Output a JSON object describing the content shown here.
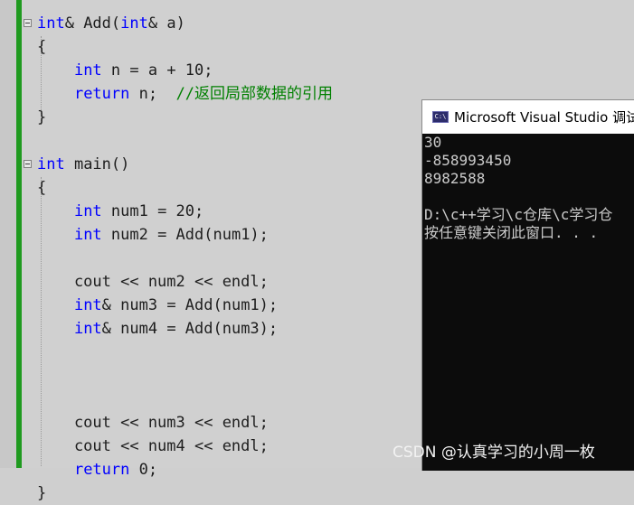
{
  "editor": {
    "lines": [
      {
        "parts": [
          {
            "t": "int",
            "c": "kw"
          },
          {
            "t": "& Add("
          },
          {
            "t": "int",
            "c": "kw"
          },
          {
            "t": "& a)"
          }
        ]
      },
      {
        "parts": [
          {
            "t": "{"
          }
        ]
      },
      {
        "parts": [
          {
            "t": "    "
          },
          {
            "t": "int",
            "c": "kw"
          },
          {
            "t": " n = a + 10;"
          }
        ]
      },
      {
        "parts": [
          {
            "t": "    "
          },
          {
            "t": "return",
            "c": "kw"
          },
          {
            "t": " n;  "
          },
          {
            "t": "//返回局部数据的引用",
            "c": "cm"
          }
        ]
      },
      {
        "parts": [
          {
            "t": "}"
          }
        ]
      },
      {
        "parts": [
          {
            "t": ""
          }
        ]
      },
      {
        "parts": [
          {
            "t": "int",
            "c": "kw"
          },
          {
            "t": " main()"
          }
        ]
      },
      {
        "parts": [
          {
            "t": "{"
          }
        ]
      },
      {
        "parts": [
          {
            "t": "    "
          },
          {
            "t": "int",
            "c": "kw"
          },
          {
            "t": " num1 = 20;"
          }
        ]
      },
      {
        "parts": [
          {
            "t": "    "
          },
          {
            "t": "int",
            "c": "kw"
          },
          {
            "t": " num2 = Add(num1);"
          }
        ]
      },
      {
        "parts": [
          {
            "t": ""
          }
        ]
      },
      {
        "parts": [
          {
            "t": "    cout << num2 << endl;"
          }
        ]
      },
      {
        "parts": [
          {
            "t": "    "
          },
          {
            "t": "int",
            "c": "kw"
          },
          {
            "t": "& num3 = Add(num1);"
          }
        ]
      },
      {
        "parts": [
          {
            "t": "    "
          },
          {
            "t": "int",
            "c": "kw"
          },
          {
            "t": "& num4 = Add(num3);"
          }
        ]
      },
      {
        "parts": [
          {
            "t": ""
          }
        ]
      },
      {
        "parts": [
          {
            "t": ""
          }
        ]
      },
      {
        "parts": [
          {
            "t": ""
          }
        ]
      },
      {
        "parts": [
          {
            "t": "    cout << num3 << endl;"
          }
        ]
      },
      {
        "parts": [
          {
            "t": "    cout << num4 << endl;"
          }
        ]
      },
      {
        "parts": [
          {
            "t": "    "
          },
          {
            "t": "return",
            "c": "kw"
          },
          {
            "t": " 0;"
          }
        ]
      },
      {
        "parts": [
          {
            "t": "}"
          }
        ]
      }
    ]
  },
  "console": {
    "title": "Microsoft Visual Studio 调试",
    "icon": "console-app-icon",
    "lines": [
      "30",
      "-858993450",
      "8982588",
      "",
      "D:\\c++学习\\c仓库\\c学习仓",
      "按任意键关闭此窗口. . ."
    ]
  },
  "watermark": "CSDN @认真学习的小周一枚",
  "colors": {
    "keyword": "#0000ff",
    "comment": "#008000",
    "changeBar": "#1f9a1f",
    "consoleBg": "#0c0c0c",
    "consoleText": "#cccccc"
  }
}
